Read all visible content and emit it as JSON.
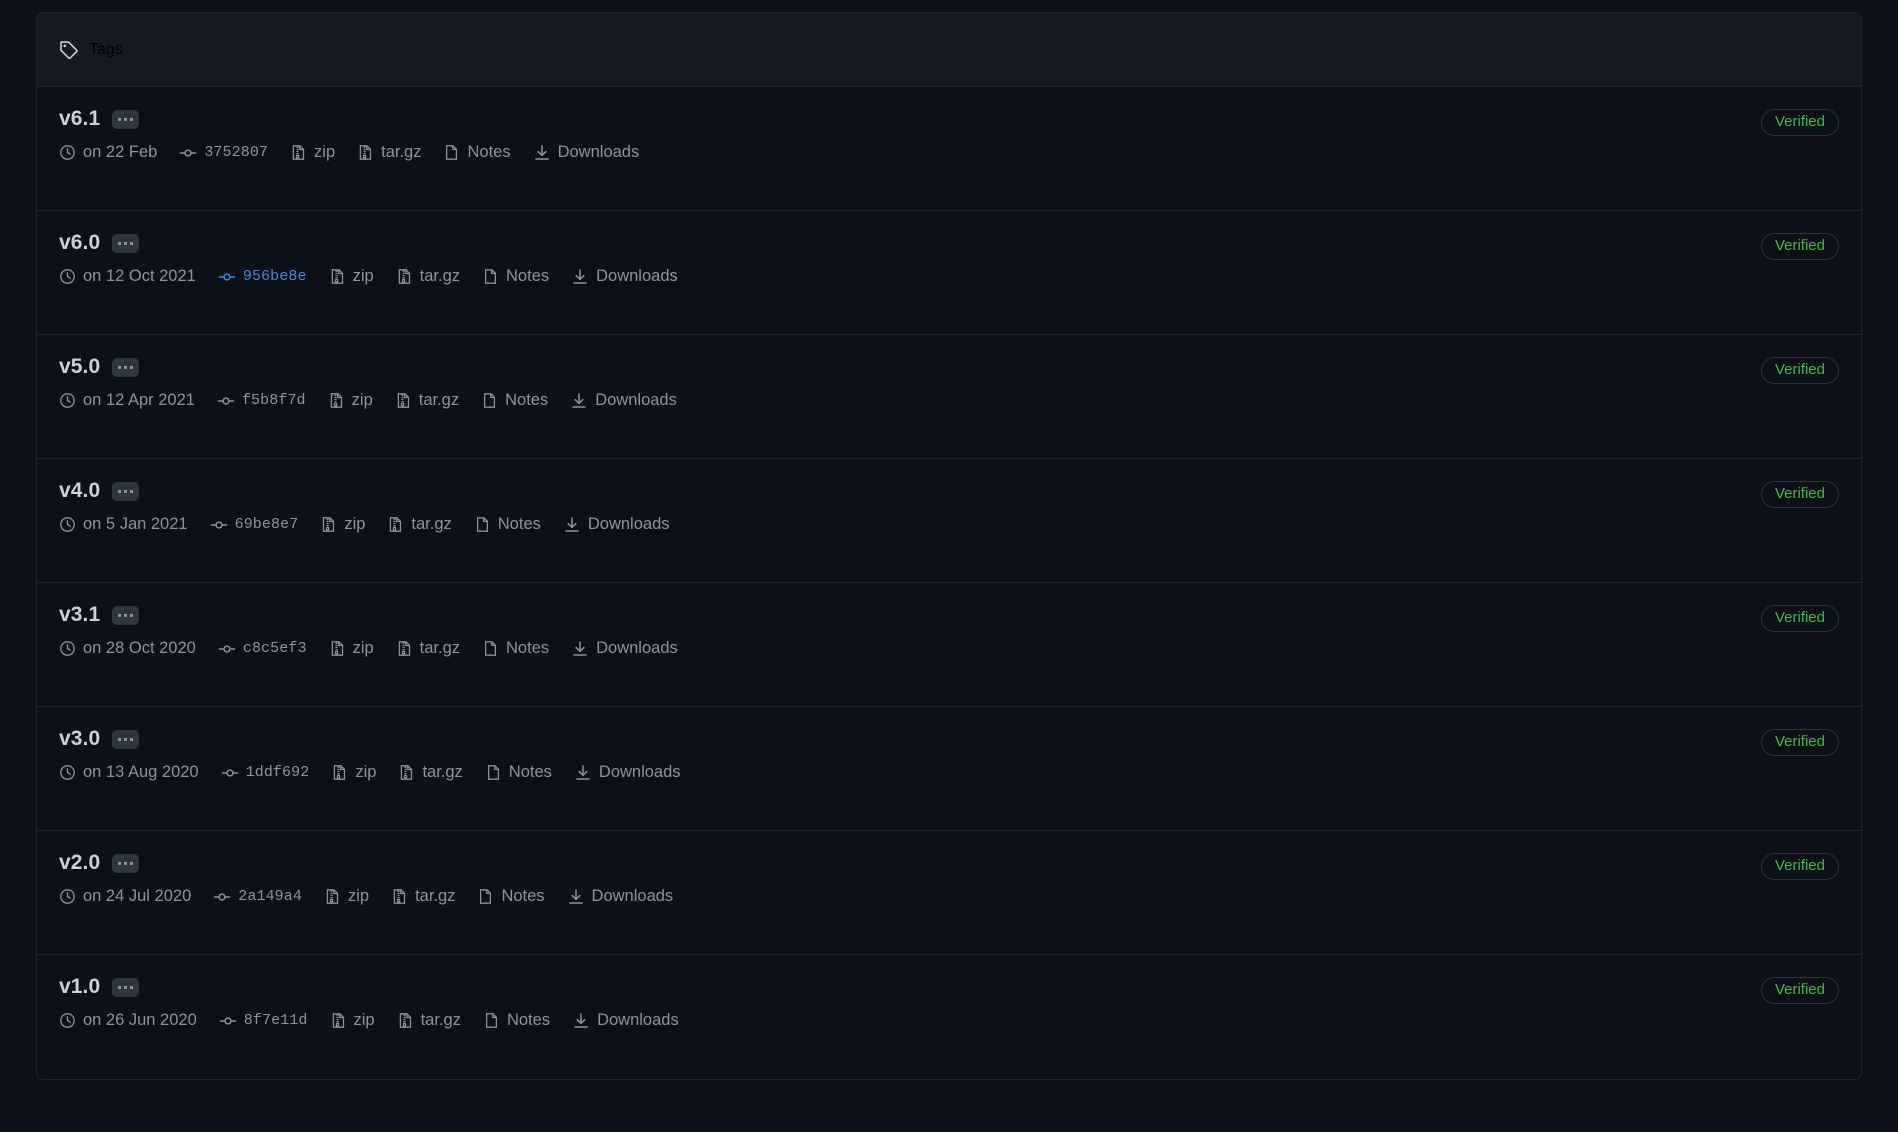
{
  "header": {
    "icon": "tag-icon",
    "title": "Tags"
  },
  "labels": {
    "zip": "zip",
    "targz": "tar.gz",
    "notes": "Notes",
    "downloads": "Downloads",
    "verified": "Verified",
    "ellipsis": "..."
  },
  "colors": {
    "page_background": "#0d1117",
    "panel_header_background": "#161b22",
    "border": "#21262d",
    "text_primary": "#c9d1d9",
    "text_muted": "#8b949e",
    "verified_green": "#3fb950",
    "link_blue": "#4d86d6",
    "button_background": "#30363d"
  },
  "tags": [
    {
      "name": "v6.1",
      "date": "on 22 Feb",
      "commit": "3752807",
      "commit_highlighted": false,
      "zip": "zip",
      "targz": "tar.gz",
      "notes": "Notes",
      "downloads": "Downloads",
      "verified": "Verified"
    },
    {
      "name": "v6.0",
      "date": "on 12 Oct 2021",
      "commit": "956be8e",
      "commit_highlighted": true,
      "zip": "zip",
      "targz": "tar.gz",
      "notes": "Notes",
      "downloads": "Downloads",
      "verified": "Verified"
    },
    {
      "name": "v5.0",
      "date": "on 12 Apr 2021",
      "commit": "f5b8f7d",
      "commit_highlighted": false,
      "zip": "zip",
      "targz": "tar.gz",
      "notes": "Notes",
      "downloads": "Downloads",
      "verified": "Verified"
    },
    {
      "name": "v4.0",
      "date": "on 5 Jan 2021",
      "commit": "69be8e7",
      "commit_highlighted": false,
      "zip": "zip",
      "targz": "tar.gz",
      "notes": "Notes",
      "downloads": "Downloads",
      "verified": "Verified"
    },
    {
      "name": "v3.1",
      "date": "on 28 Oct 2020",
      "commit": "c8c5ef3",
      "commit_highlighted": false,
      "zip": "zip",
      "targz": "tar.gz",
      "notes": "Notes",
      "downloads": "Downloads",
      "verified": "Verified"
    },
    {
      "name": "v3.0",
      "date": "on 13 Aug 2020",
      "commit": "1ddf692",
      "commit_highlighted": false,
      "zip": "zip",
      "targz": "tar.gz",
      "notes": "Notes",
      "downloads": "Downloads",
      "verified": "Verified"
    },
    {
      "name": "v2.0",
      "date": "on 24 Jul 2020",
      "commit": "2a149a4",
      "commit_highlighted": false,
      "zip": "zip",
      "targz": "tar.gz",
      "notes": "Notes",
      "downloads": "Downloads",
      "verified": "Verified"
    },
    {
      "name": "v1.0",
      "date": "on 26 Jun 2020",
      "commit": "8f7e11d",
      "commit_highlighted": false,
      "zip": "zip",
      "targz": "tar.gz",
      "notes": "Notes",
      "downloads": "Downloads",
      "verified": "Verified"
    }
  ]
}
